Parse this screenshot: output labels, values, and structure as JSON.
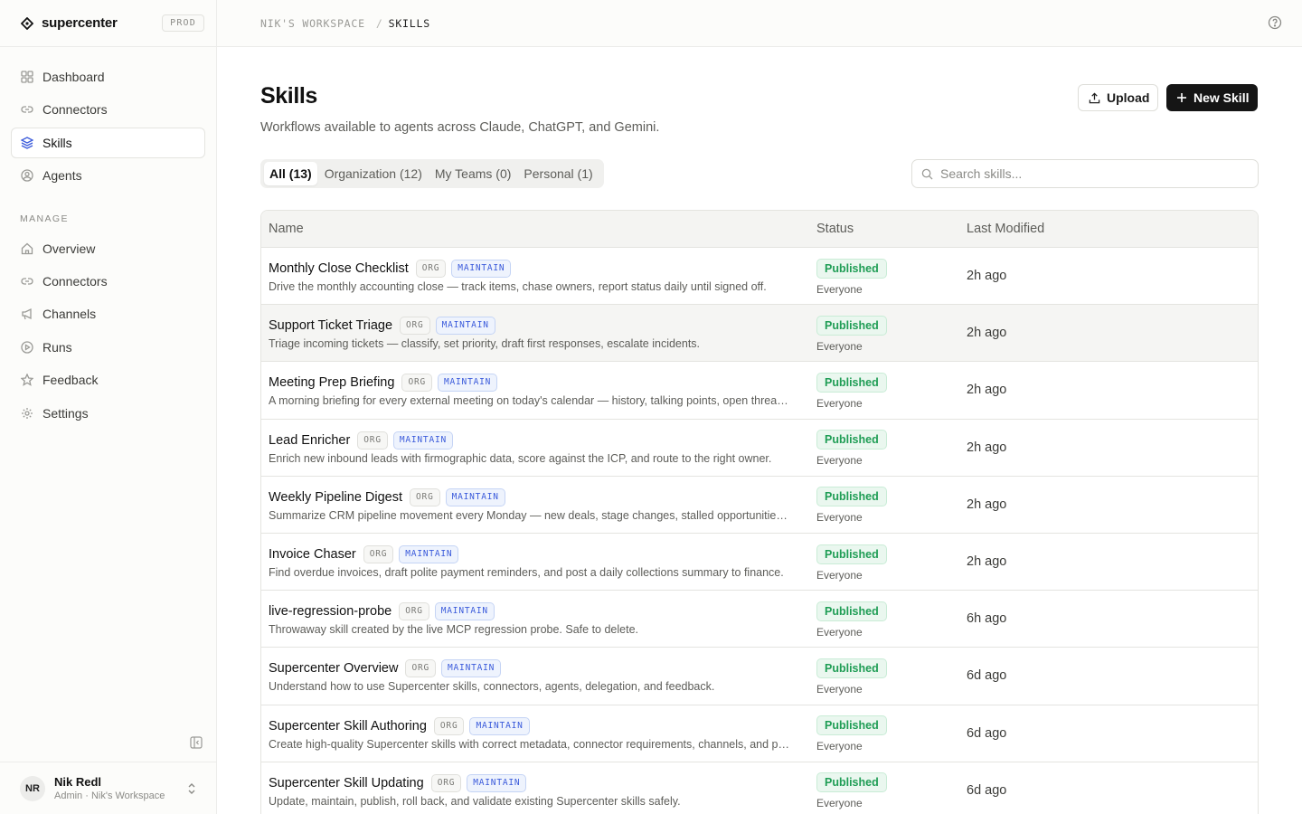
{
  "brand": {
    "name": "supercenter",
    "env": "PROD"
  },
  "sidebar": {
    "items": [
      {
        "label": "Dashboard",
        "icon": "dashboard-icon"
      },
      {
        "label": "Connectors",
        "icon": "link-icon"
      },
      {
        "label": "Skills",
        "icon": "layers-icon",
        "active": true
      },
      {
        "label": "Agents",
        "icon": "user-circle-icon"
      }
    ],
    "manage_label": "MANAGE",
    "manage_items": [
      {
        "label": "Overview",
        "icon": "home-icon"
      },
      {
        "label": "Connectors",
        "icon": "link-icon"
      },
      {
        "label": "Channels",
        "icon": "megaphone-icon"
      },
      {
        "label": "Runs",
        "icon": "play-circle-icon"
      },
      {
        "label": "Feedback",
        "icon": "star-icon"
      },
      {
        "label": "Settings",
        "icon": "gear-icon"
      }
    ]
  },
  "user": {
    "initials": "NR",
    "name": "Nik Redl",
    "subtitle": "Admin · Nik's Workspace"
  },
  "breadcrumb": {
    "workspace": "NIK'S WORKSPACE",
    "separator": "/",
    "current": "SKILLS"
  },
  "page": {
    "title": "Skills",
    "subtitle": "Workflows available to agents across Claude, ChatGPT, and Gemini.",
    "upload_label": "Upload",
    "new_label": "New Skill"
  },
  "tabs": [
    {
      "label": "All (13)",
      "active": true
    },
    {
      "label": "Organization (12)"
    },
    {
      "label": "My Teams (0)"
    },
    {
      "label": "Personal (1)"
    }
  ],
  "search": {
    "placeholder": "Search skills..."
  },
  "table": {
    "headers": {
      "name": "Name",
      "status": "Status",
      "modified": "Last Modified"
    },
    "rows": [
      {
        "name": "Monthly Close Checklist",
        "scope": "ORG",
        "perm": "MAINTAIN",
        "desc": "Drive the monthly accounting close — track items, chase owners, report status daily until signed off.",
        "status": "Published",
        "audience": "Everyone",
        "modified": "2h ago"
      },
      {
        "name": "Support Ticket Triage",
        "scope": "ORG",
        "perm": "MAINTAIN",
        "desc": "Triage incoming tickets — classify, set priority, draft first responses, escalate incidents.",
        "status": "Published",
        "audience": "Everyone",
        "modified": "2h ago",
        "hover": true
      },
      {
        "name": "Meeting Prep Briefing",
        "scope": "ORG",
        "perm": "MAINTAIN",
        "desc": "A morning briefing for every external meeting on today's calendar — history, talking points, open threads.",
        "status": "Published",
        "audience": "Everyone",
        "modified": "2h ago"
      },
      {
        "name": "Lead Enricher",
        "scope": "ORG",
        "perm": "MAINTAIN",
        "desc": "Enrich new inbound leads with firmographic data, score against the ICP, and route to the right owner.",
        "status": "Published",
        "audience": "Everyone",
        "modified": "2h ago"
      },
      {
        "name": "Weekly Pipeline Digest",
        "scope": "ORG",
        "perm": "MAINTAIN",
        "desc": "Summarize CRM pipeline movement every Monday — new deals, stage changes, stalled opportunities, risks.",
        "status": "Published",
        "audience": "Everyone",
        "modified": "2h ago"
      },
      {
        "name": "Invoice Chaser",
        "scope": "ORG",
        "perm": "MAINTAIN",
        "desc": "Find overdue invoices, draft polite payment reminders, and post a daily collections summary to finance.",
        "status": "Published",
        "audience": "Everyone",
        "modified": "2h ago"
      },
      {
        "name": "live-regression-probe",
        "scope": "ORG",
        "perm": "MAINTAIN",
        "desc": "Throwaway skill created by the live MCP regression probe. Safe to delete.",
        "status": "Published",
        "audience": "Everyone",
        "modified": "6h ago"
      },
      {
        "name": "Supercenter Overview",
        "scope": "ORG",
        "perm": "MAINTAIN",
        "desc": "Understand how to use Supercenter skills, connectors, agents, delegation, and feedback.",
        "status": "Published",
        "audience": "Everyone",
        "modified": "6d ago"
      },
      {
        "name": "Supercenter Skill Authoring",
        "scope": "ORG",
        "perm": "MAINTAIN",
        "desc": "Create high-quality Supercenter skills with correct metadata, connector requirements, channels, and publishing.",
        "status": "Published",
        "audience": "Everyone",
        "modified": "6d ago"
      },
      {
        "name": "Supercenter Skill Updating",
        "scope": "ORG",
        "perm": "MAINTAIN",
        "desc": "Update, maintain, publish, roll back, and validate existing Supercenter skills safely.",
        "status": "Published",
        "audience": "Everyone",
        "modified": "6d ago"
      }
    ]
  }
}
